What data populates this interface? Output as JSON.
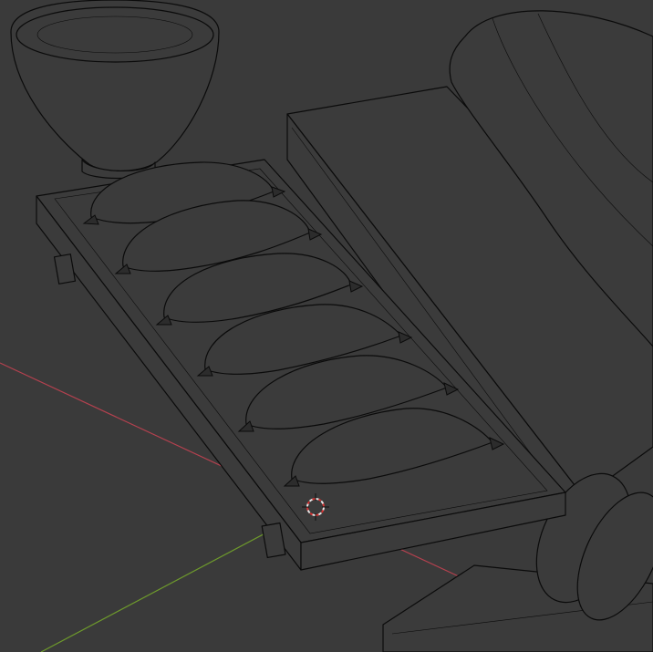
{
  "app": {
    "mode": "wireframe-viewport"
  },
  "colors": {
    "background": "#3a3a3a",
    "wire": "#0b0b0b",
    "x_axis": "#b4414f",
    "y_axis": "#6e9a2c",
    "cursor_ring": "#e6e6e6",
    "cursor_accent": "#d23232"
  },
  "objects": {
    "bowl": "bowl",
    "tray": "tray",
    "bananas": [
      "banana",
      "banana",
      "banana",
      "banana",
      "banana",
      "banana"
    ],
    "cutting_board": "cutting-board",
    "bread_loaf": "bread-loaf",
    "bread_slices": "bread-slices",
    "second_board": "board"
  },
  "icons": {
    "cursor": "3d-cursor-icon"
  }
}
